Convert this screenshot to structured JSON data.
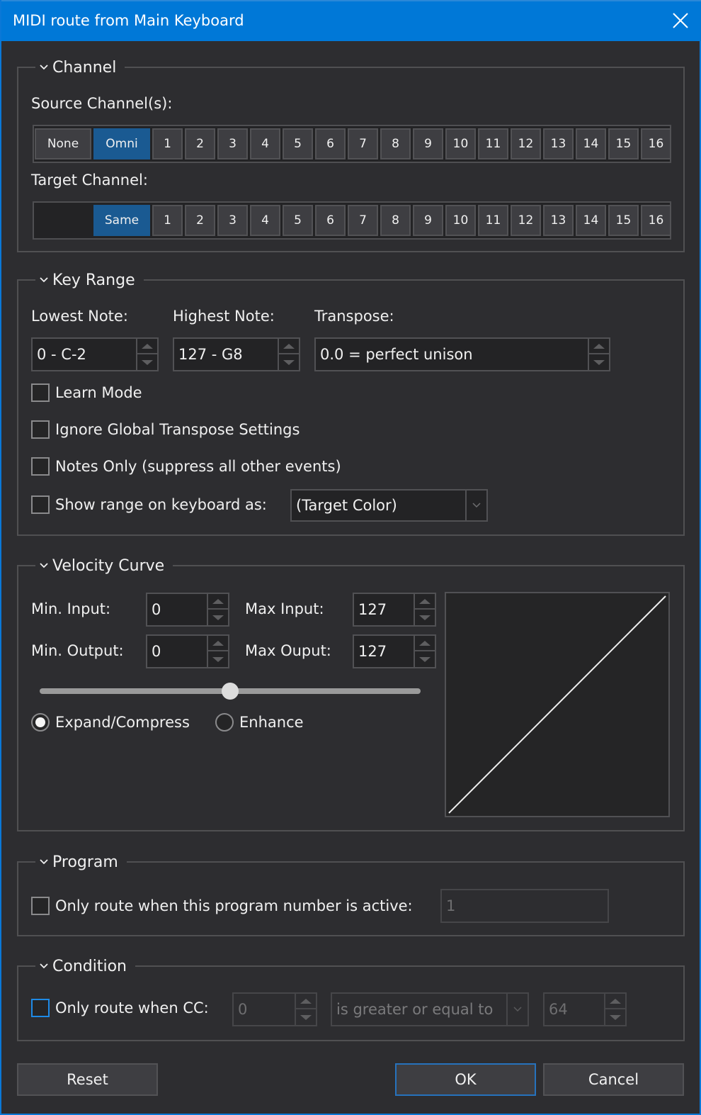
{
  "window": {
    "title": "MIDI route from Main Keyboard",
    "close_icon": "close-x-icon"
  },
  "channel": {
    "legend": "Channel",
    "source_label": "Source Channel(s):",
    "source_buttons": [
      "None",
      "Omni",
      "1",
      "2",
      "3",
      "4",
      "5",
      "6",
      "7",
      "8",
      "9",
      "10",
      "11",
      "12",
      "13",
      "14",
      "15",
      "16"
    ],
    "source_selected": "Omni",
    "target_label": "Target Channel:",
    "target_buttons": [
      "Same",
      "1",
      "2",
      "3",
      "4",
      "5",
      "6",
      "7",
      "8",
      "9",
      "10",
      "11",
      "12",
      "13",
      "14",
      "15",
      "16"
    ],
    "target_selected": "Same"
  },
  "key_range": {
    "legend": "Key Range",
    "lowest_label": "Lowest Note:",
    "lowest_value": "0 - C-2",
    "highest_label": "Highest Note:",
    "highest_value": "127 - G8",
    "transpose_label": "Transpose:",
    "transpose_value": "0.0 = perfect unison",
    "learn_mode": {
      "label": "Learn Mode",
      "checked": false
    },
    "ignore_global": {
      "label": "Ignore Global Transpose Settings",
      "checked": false
    },
    "notes_only": {
      "label": "Notes Only (suppress all other events)",
      "checked": false
    },
    "show_range": {
      "label": "Show range on keyboard as:",
      "checked": false
    },
    "show_range_value": "(Target Color)"
  },
  "velocity": {
    "legend": "Velocity Curve",
    "min_input_label": "Min. Input:",
    "min_input": "0",
    "max_input_label": "Max Input:",
    "max_input": "127",
    "min_output_label": "Min. Output:",
    "min_output": "0",
    "max_output_label": "Max Ouput:",
    "max_output": "127",
    "curve_slider_fraction": 0.5,
    "mode_expand": {
      "label": "Expand/Compress",
      "selected": true
    },
    "mode_enhance": {
      "label": "Enhance",
      "selected": false
    },
    "curve_points": [
      [
        0,
        0
      ],
      [
        127,
        127
      ]
    ]
  },
  "program": {
    "legend": "Program",
    "only_route": {
      "label": "Only route when this program number is active:",
      "checked": false
    },
    "program_number": "1"
  },
  "condition": {
    "legend": "Condition",
    "only_route_cc": {
      "label": "Only route when CC:",
      "checked": false
    },
    "cc_number": "0",
    "comparison": "is greater or equal to",
    "cc_value": "64"
  },
  "buttons": {
    "reset": "Reset",
    "ok": "OK",
    "cancel": "Cancel"
  }
}
